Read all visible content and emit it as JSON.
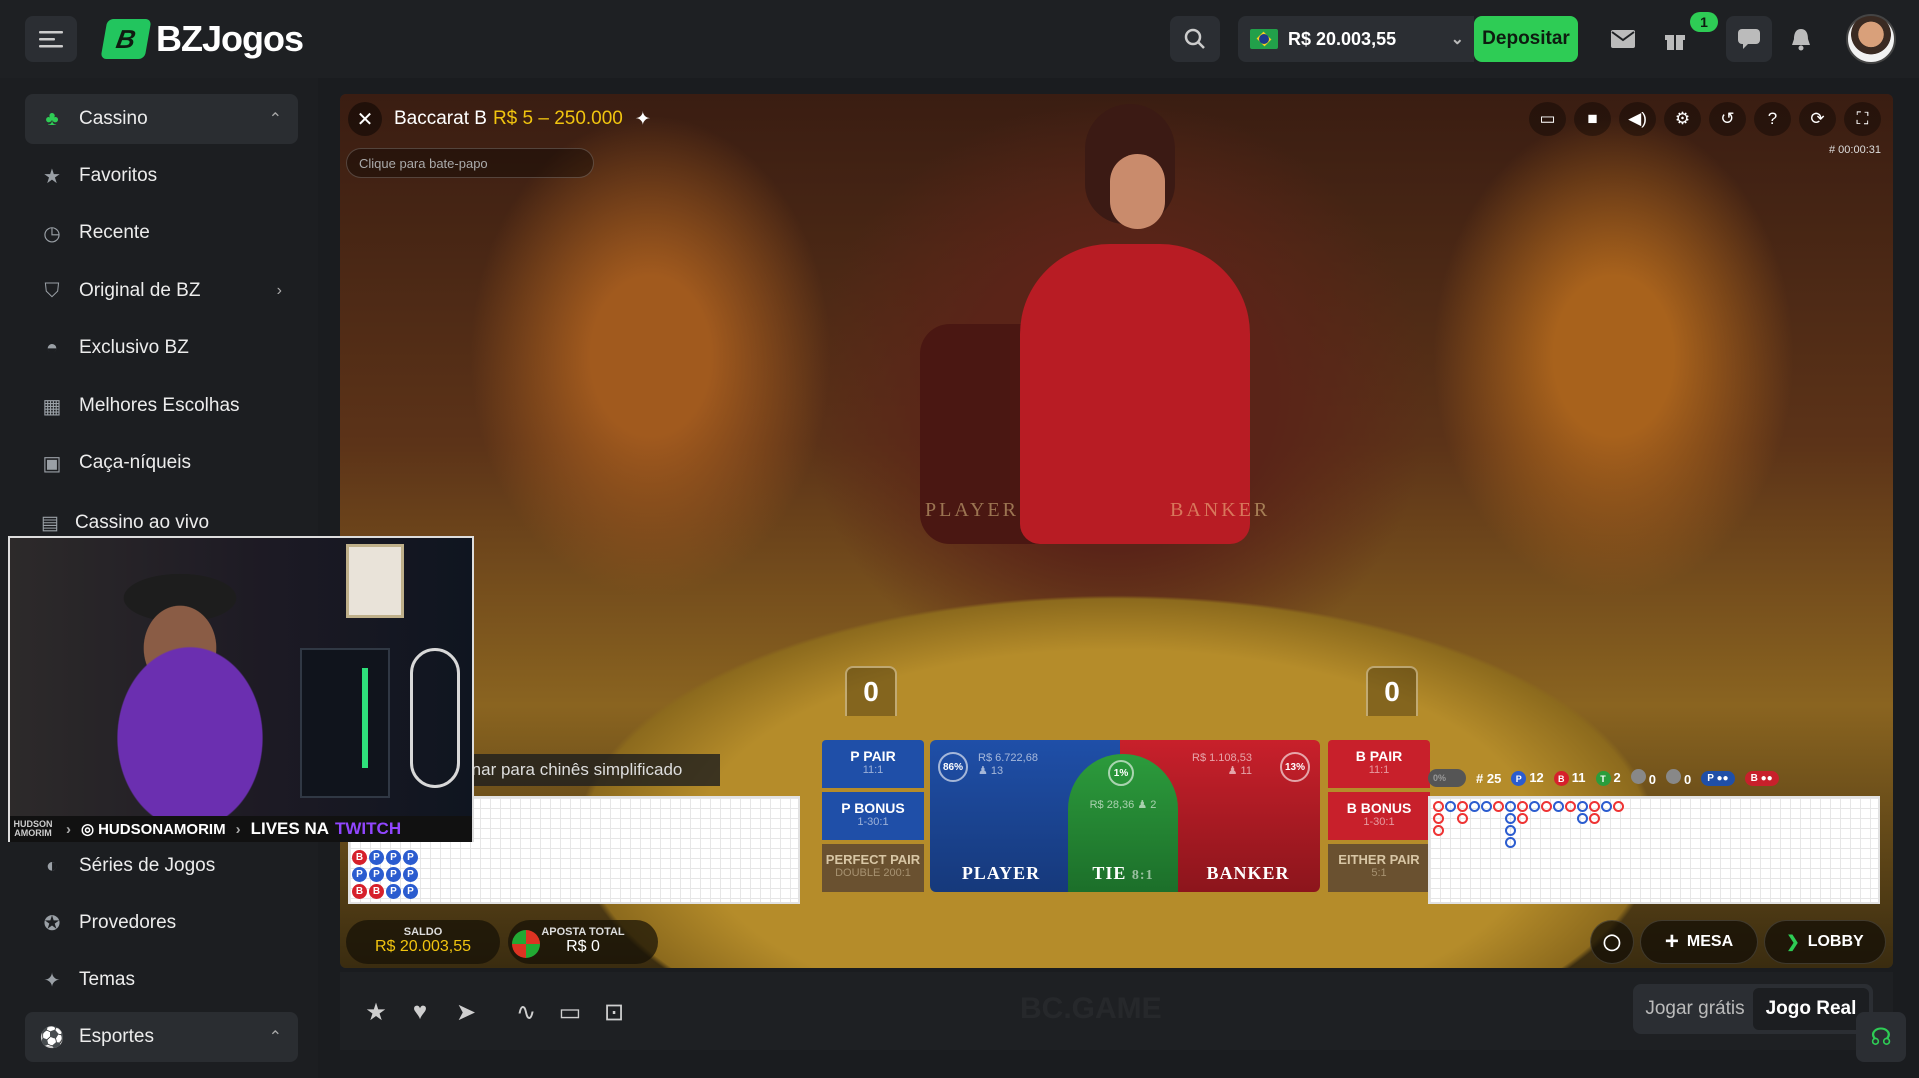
{
  "header": {
    "logo_text": "BZJogos",
    "logo_mark": "B",
    "balance": "R$ 20.003,55",
    "deposit_label": "Depositar",
    "gift_badge": "1"
  },
  "sidebar": {
    "items": [
      {
        "label": "Cassino",
        "icon": "casino-icon"
      },
      {
        "label": "Favoritos",
        "icon": "star-icon"
      },
      {
        "label": "Recente",
        "icon": "clock-icon"
      },
      {
        "label": "Original de BZ",
        "icon": "original-icon"
      },
      {
        "label": "Exclusivo BZ",
        "icon": "exclusive-icon"
      },
      {
        "label": "Melhores Escolhas",
        "icon": "grid-icon"
      },
      {
        "label": "Caça-níqueis",
        "icon": "slot-icon"
      },
      {
        "label": "Cassino ao vivo",
        "icon": "live-icon"
      },
      {
        "label": "Séries de Jogos",
        "icon": "series-icon"
      },
      {
        "label": "Provedores",
        "icon": "providers-icon"
      },
      {
        "label": "Temas",
        "icon": "themes-icon"
      },
      {
        "label": "Esportes",
        "icon": "sports-icon"
      }
    ]
  },
  "game": {
    "title": "Baccarat B",
    "limits": "R$ 5 – 250.000",
    "chat_placeholder": "Clique para bate-papo",
    "timer": "# 00:00:31",
    "table_player": "PLAYER",
    "table_banker": "BANKER",
    "player_score": "0",
    "banker_score": "0",
    "translate_tip": "rnar para chinês simplificado"
  },
  "bets": {
    "p_pair": {
      "label": "P PAIR",
      "ratio": "11:1"
    },
    "p_bonus": {
      "label": "P BONUS",
      "ratio": "1-30:1"
    },
    "perfect_pair": {
      "label": "PERFECT PAIR",
      "ratio": "DOUBLE 200:1"
    },
    "player": {
      "label": "PLAYER",
      "stake": "R$ 6.722,68",
      "players": "13",
      "pct": "86%"
    },
    "tie": {
      "label": "TIE",
      "ratio": "8:1",
      "stake": "R$ 28,36",
      "players": "2",
      "pct": "1%"
    },
    "banker": {
      "label": "BANKER",
      "stake": "R$ 1.108,53",
      "players": "11",
      "pct": "13%"
    },
    "b_pair": {
      "label": "B PAIR",
      "ratio": "11:1"
    },
    "b_bonus": {
      "label": "B BONUS",
      "ratio": "1-30:1"
    },
    "either_pair": {
      "label": "EITHER PAIR",
      "ratio": "5:1"
    }
  },
  "stats": {
    "toggle": "0%",
    "round": "# 25",
    "player_wins": "12",
    "banker_wins": "11",
    "ties": "2",
    "player_pairs": "0",
    "banker_pairs": "0",
    "p_label": "P",
    "b_label": "B",
    "t_label": "T"
  },
  "bead_road": [
    [
      "B",
      "P",
      "P",
      "P"
    ],
    [
      "P",
      "P",
      "P",
      "P"
    ],
    [
      "B",
      "B",
      "P",
      "P"
    ]
  ],
  "footer": {
    "saldo_label": "SALDO",
    "saldo_value": "R$ 20.003,55",
    "aposta_label": "APOSTA TOTAL",
    "aposta_value": "R$ 0",
    "mesa_label": "MESA",
    "lobby_label": "LOBBY"
  },
  "webcam": {
    "signature": "HUDSON AMORIM",
    "handle": "HUDSONAMORIM",
    "banner_prefix": "LIVES NA",
    "banner_brand": "TWITCH"
  },
  "bottom": {
    "free_label": "Jogar grátis",
    "real_label": "Jogo Real",
    "watermark": "BC.GAME"
  }
}
